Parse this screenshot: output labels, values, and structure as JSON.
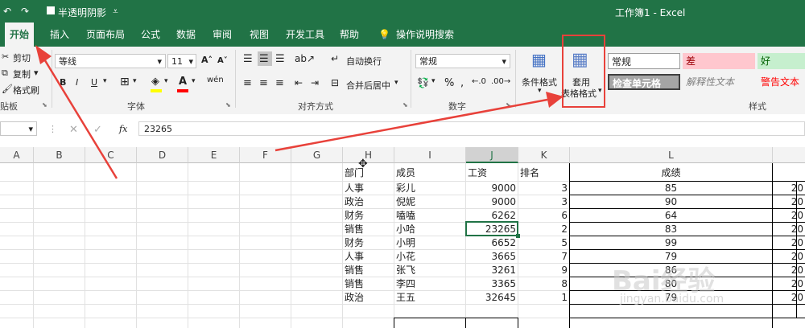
{
  "title_bar": {
    "doc_title": "半透明阴影",
    "app_title": "工作簿1 - Excel"
  },
  "tabs": [
    "开始",
    "插入",
    "页面布局",
    "公式",
    "数据",
    "审阅",
    "视图",
    "开发工具",
    "帮助",
    "操作说明搜索"
  ],
  "ribbon": {
    "clipboard": {
      "cut": "剪切",
      "copy": "复制",
      "format_painter": "格式刷",
      "label": "贴板"
    },
    "font": {
      "name": "等线",
      "size": "11",
      "label": "字体"
    },
    "alignment": {
      "wrap": "自动换行",
      "merge": "合并后居中",
      "label": "对齐方式"
    },
    "number": {
      "format": "常规",
      "label": "数字"
    },
    "styles": {
      "conditional": "条件格式",
      "table_line1": "套用",
      "table_line2": "表格格式",
      "normal": "常规",
      "bad": "差",
      "good": "好",
      "check": "检查单元格",
      "explanatory": "解释性文本",
      "warning": "警告文本",
      "label": "样式"
    }
  },
  "formula_bar": {
    "value": "23265",
    "fx": "fx"
  },
  "columns": [
    "A",
    "B",
    "C",
    "D",
    "E",
    "F",
    "G",
    "H",
    "I",
    "J",
    "K",
    "L"
  ],
  "headers": {
    "dept": "部门",
    "member": "成员",
    "salary": "工资",
    "rank": "排名",
    "score": "成绩"
  },
  "rows": [
    {
      "dept": "人事",
      "member": "彩儿",
      "salary": "9000",
      "rank": "3",
      "score": "85",
      "extra": "20"
    },
    {
      "dept": "政治",
      "member": "倪妮",
      "salary": "9000",
      "rank": "3",
      "score": "90",
      "extra": "20"
    },
    {
      "dept": "财务",
      "member": "嗑嗑",
      "salary": "6262",
      "rank": "6",
      "score": "64",
      "extra": "20"
    },
    {
      "dept": "销售",
      "member": "小哈",
      "salary": "23265",
      "rank": "2",
      "score": "83",
      "extra": "20"
    },
    {
      "dept": "财务",
      "member": "小明",
      "salary": "6652",
      "rank": "5",
      "score": "99",
      "extra": "20"
    },
    {
      "dept": "人事",
      "member": "小花",
      "salary": "3665",
      "rank": "7",
      "score": "79",
      "extra": "20"
    },
    {
      "dept": "销售",
      "member": "张飞",
      "salary": "3261",
      "rank": "9",
      "score": "86",
      "extra": "20"
    },
    {
      "dept": "销售",
      "member": "李四",
      "salary": "3365",
      "rank": "8",
      "score": "80",
      "extra": "20"
    },
    {
      "dept": "政治",
      "member": "王五",
      "salary": "32645",
      "rank": "1",
      "score": "79",
      "extra": "20"
    }
  ],
  "watermark": {
    "brand": "Bai经验",
    "url": "jingyan.baidu.com"
  },
  "colors": {
    "excel_green": "#217346",
    "bad_bg": "#ffc7ce",
    "good_bg": "#c6efce",
    "check_bg": "#a5a5a5",
    "warning": "#ff0000",
    "arrow": "#e8413a"
  }
}
